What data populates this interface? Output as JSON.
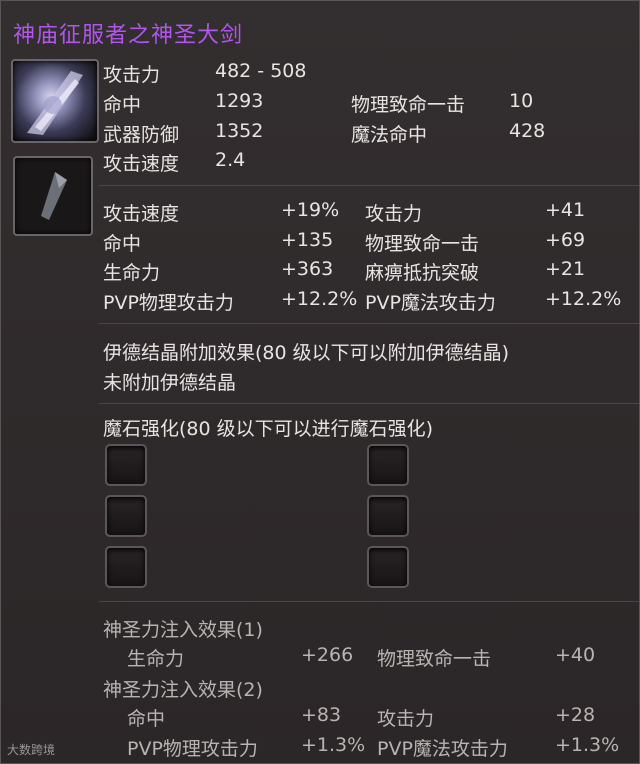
{
  "item_name": "神庙征服者之神圣大剑",
  "base_stats": [
    {
      "label": "攻击力",
      "value": "482 - 508"
    },
    {
      "label": "命中",
      "value": "1293",
      "label2": "物理致命一击",
      "value2": "10"
    },
    {
      "label": "武器防御",
      "value": "1352",
      "label2": "魔法命中",
      "value2": "428"
    },
    {
      "label": "攻击速度",
      "value": "2.4"
    }
  ],
  "bonus_stats": [
    {
      "l1": "攻击速度",
      "v1": "+19%",
      "l2": "攻击力",
      "v2": "+41"
    },
    {
      "l1": "命中",
      "v1": "+135",
      "l2": "物理致命一击",
      "v2": "+69"
    },
    {
      "l1": "生命力",
      "v1": "+363",
      "l2": "麻痹抵抗突破",
      "v2": "+21"
    },
    {
      "l1": "PVP物理攻击力",
      "v1": "+12.2%",
      "l2": "PVP魔法攻击力",
      "v2": "+12.2%"
    }
  ],
  "idian": {
    "header": "伊德结晶附加效果(80 级以下可以附加伊德结晶)",
    "status": "未附加伊德结晶"
  },
  "manastone": {
    "header": "魔石强化(80 级以下可以进行魔石强化)",
    "slot_count": 6
  },
  "holy": {
    "group1_header": "神圣力注入效果(1)",
    "group1": {
      "l1": "生命力",
      "v1": "+266",
      "l2": "物理致命一击",
      "v2": "+40"
    },
    "group2_header": "神圣力注入效果(2)",
    "group2": [
      {
        "l1": "命中",
        "v1": "+83",
        "l2": "攻击力",
        "v2": "+28"
      },
      {
        "l1": "PVP物理攻击力",
        "v1": "+1.3%",
        "l2": "PVP魔法攻击力",
        "v2": "+1.3%"
      }
    ]
  },
  "watermark": "大数跨境"
}
